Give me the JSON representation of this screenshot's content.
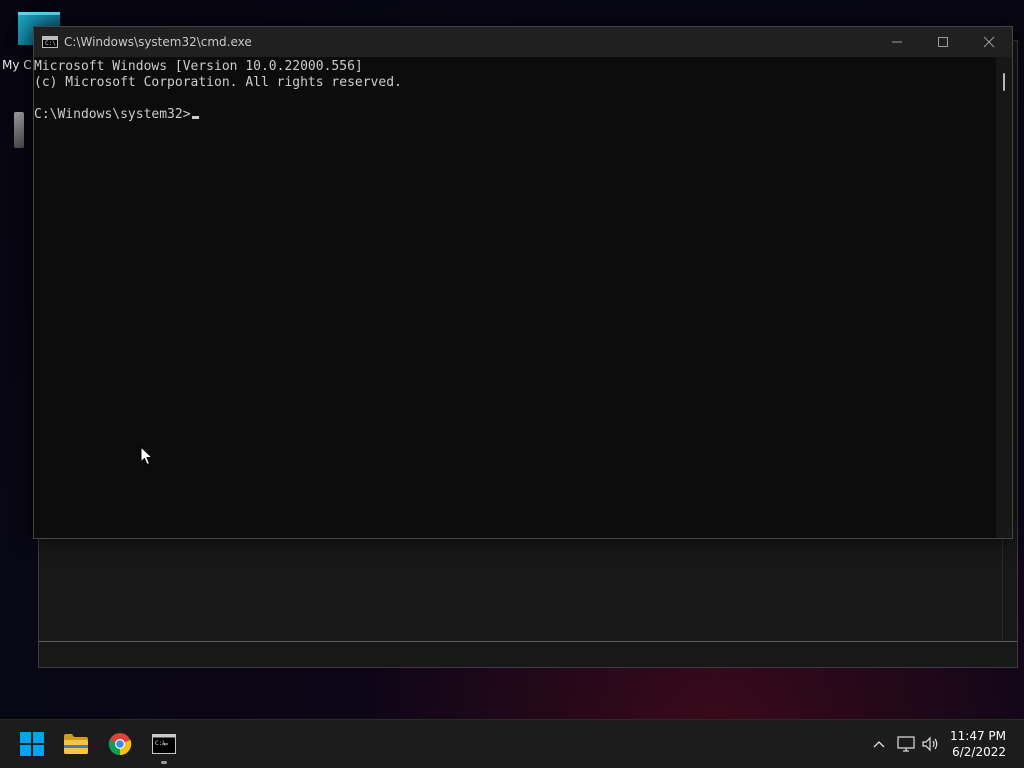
{
  "desktop": {
    "icons": [
      {
        "label": "My C",
        "icon": "computer-icon"
      },
      {
        "label": "",
        "icon": "app-icon"
      }
    ]
  },
  "cmd_window": {
    "title": "C:\\Windows\\system32\\cmd.exe",
    "icon": "cmd-icon",
    "icon_text": "C:\\",
    "buttons": {
      "minimize": "minimize-icon",
      "maximize": "maximize-icon",
      "close": "close-icon"
    },
    "console_lines": [
      "Microsoft Windows [Version 10.0.22000.556]",
      "(c) Microsoft Corporation. All rights reserved.",
      "",
      "C:\\Windows\\system32>"
    ]
  },
  "taskbar": {
    "items": [
      {
        "name": "start",
        "icon": "windows-logo-icon"
      },
      {
        "name": "file-explorer",
        "icon": "folder-icon"
      },
      {
        "name": "chrome",
        "icon": "chrome-icon"
      },
      {
        "name": "command-prompt",
        "icon": "cmd-icon",
        "active": true
      }
    ],
    "tray": {
      "icons": [
        "chevron-up-icon",
        "network-icon",
        "volume-icon"
      ]
    },
    "clock": {
      "time": "11:47 PM",
      "date": "6/2/2022"
    }
  },
  "colors": {
    "console_bg": "#0c0c0c",
    "console_text": "#cccccc",
    "titlebar_bg": "#202020",
    "taskbar_bg": "#1c1c1c",
    "win_blue": "#00a4ef"
  }
}
